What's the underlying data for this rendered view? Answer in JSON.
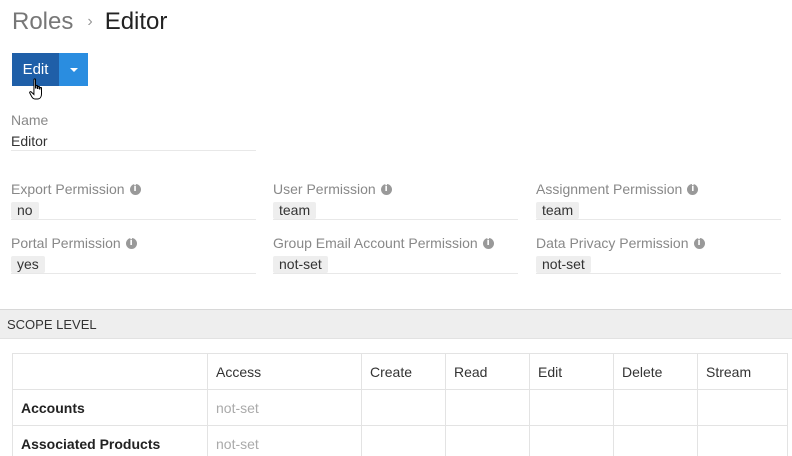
{
  "breadcrumb": {
    "root": "Roles",
    "separator": "›",
    "current": "Editor"
  },
  "actions": {
    "edit_label": "Edit"
  },
  "fields": {
    "name": {
      "label": "Name",
      "value": "Editor"
    },
    "export_permission": {
      "label": "Export Permission",
      "value": "no"
    },
    "user_permission": {
      "label": "User Permission",
      "value": "team"
    },
    "assignment_permission": {
      "label": "Assignment Permission",
      "value": "team"
    },
    "portal_permission": {
      "label": "Portal Permission",
      "value": "yes"
    },
    "group_email_permission": {
      "label": "Group Email Account Permission",
      "value": "not-set"
    },
    "data_privacy_permission": {
      "label": "Data Privacy Permission",
      "value": "not-set"
    }
  },
  "scope": {
    "title": "SCOPE LEVEL",
    "columns": [
      "",
      "Access",
      "Create",
      "Read",
      "Edit",
      "Delete",
      "Stream"
    ],
    "rows": [
      {
        "name": "Accounts",
        "access": "not-set"
      },
      {
        "name": "Associated Products",
        "access": "not-set"
      }
    ]
  },
  "icons": {
    "info": "info-icon",
    "caret": "caret-down-icon",
    "cursor": "hand-pointer-icon"
  },
  "colors": {
    "primary": "#1f5fa8",
    "primary_light": "#2a8de0"
  }
}
